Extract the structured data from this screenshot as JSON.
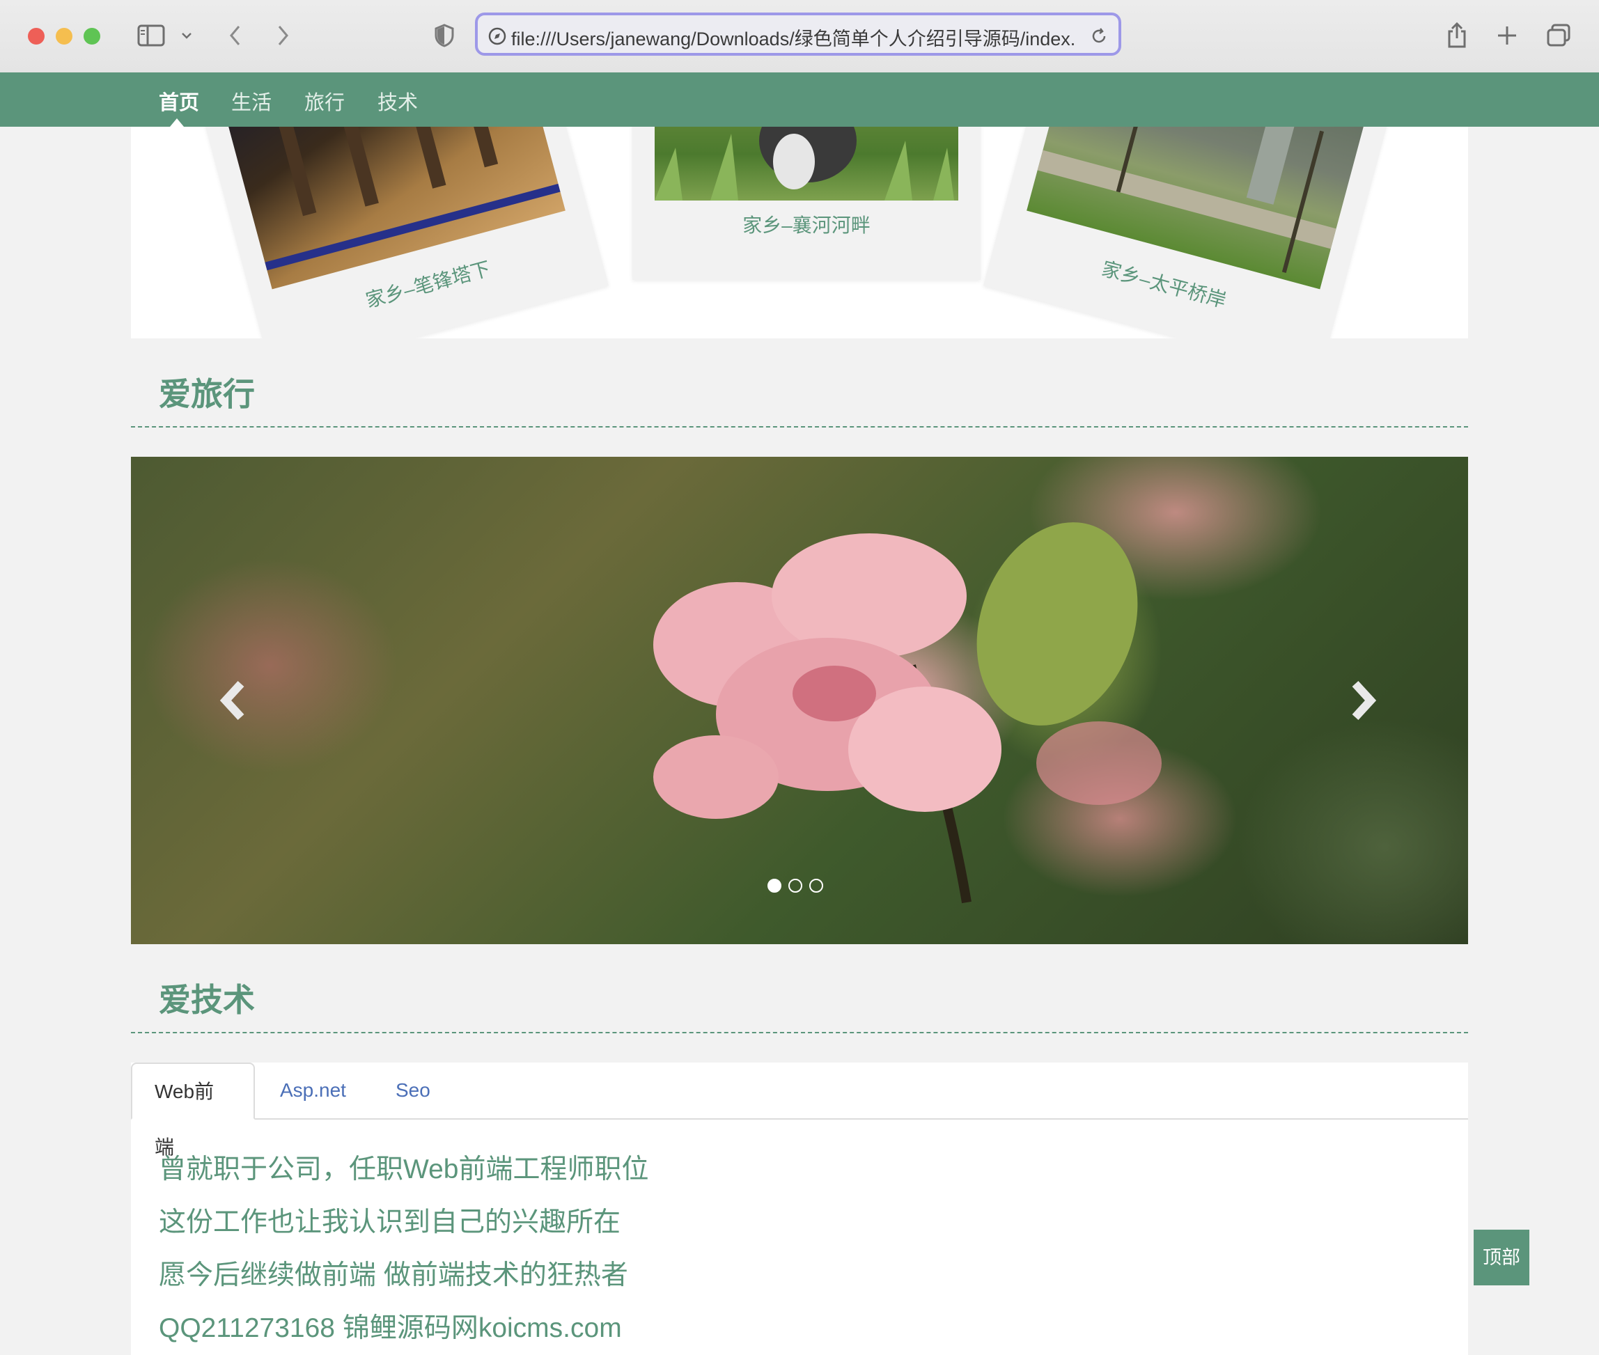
{
  "browser": {
    "url": "file:///Users/janewang/Downloads/绿色简单个人介绍引导源码/index.l"
  },
  "nav": {
    "items": [
      {
        "label": "首页",
        "active": true
      },
      {
        "label": "生活",
        "active": false
      },
      {
        "label": "旅行",
        "active": false
      },
      {
        "label": "技术",
        "active": false
      }
    ]
  },
  "photos": [
    {
      "caption": "家乡–笔锋塔下"
    },
    {
      "caption": "家乡–襄河河畔"
    },
    {
      "caption": "家乡–太平桥岸"
    }
  ],
  "sections": {
    "travel_title": "爱旅行",
    "tech_title": "爱技术"
  },
  "carousel": {
    "slide_count": 3,
    "active_index": 0
  },
  "tabs": {
    "items": [
      {
        "label": "Web前端",
        "active": true
      },
      {
        "label": "Asp.net",
        "active": false
      },
      {
        "label": "Seo",
        "active": false
      }
    ],
    "content_lines": [
      "曾就职于公司，任职Web前端工程师职位",
      "这份工作也让我认识到自己的兴趣所在",
      "愿今后继续做前端 做前端技术的狂热者",
      "QQ211273168 锦鲤源码网koicms.com"
    ]
  },
  "back_to_top": "顶部",
  "colors": {
    "brand_green": "#5b957b",
    "link_blue": "#4b6fb7"
  }
}
